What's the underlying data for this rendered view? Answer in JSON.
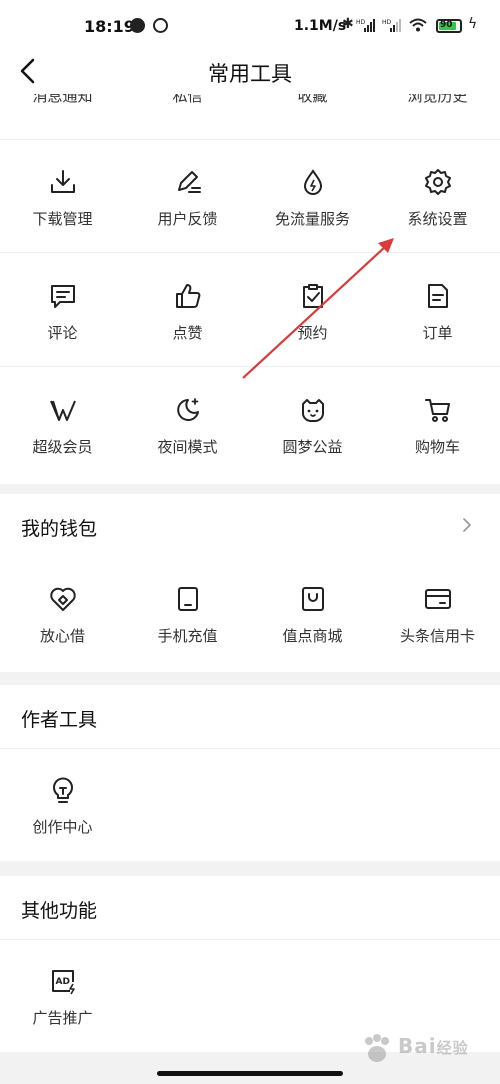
{
  "status_bar": {
    "time": "18:19",
    "net_speed": "1.1M/s",
    "battery_level": "90",
    "battery_percent": 90,
    "icons": [
      "browser-icon",
      "sync-icon",
      "bluetooth-icon",
      "signal-hd-icon",
      "signal-hd-icon",
      "wifi-icon",
      "battery-icon",
      "charging-icon"
    ]
  },
  "header": {
    "title": "常用工具",
    "back_icon": "chevron-left-icon"
  },
  "top_row_partial": [
    "消息通知",
    "私信",
    "收藏",
    "浏览历史"
  ],
  "common_tools": [
    {
      "label": "下载管理",
      "icon": "download-icon"
    },
    {
      "label": "用户反馈",
      "icon": "pen-feedback-icon"
    },
    {
      "label": "免流量服务",
      "icon": "drop-icon"
    },
    {
      "label": "系统设置",
      "icon": "gear-icon"
    },
    {
      "label": "评论",
      "icon": "comment-icon"
    },
    {
      "label": "点赞",
      "icon": "thumbs-up-icon"
    },
    {
      "label": "预约",
      "icon": "clipboard-check-icon"
    },
    {
      "label": "订单",
      "icon": "document-icon"
    },
    {
      "label": "超级会员",
      "icon": "vip-icon"
    },
    {
      "label": "夜间模式",
      "icon": "moon-icon"
    },
    {
      "label": "圆梦公益",
      "icon": "cat-face-icon"
    },
    {
      "label": "购物车",
      "icon": "cart-icon"
    }
  ],
  "wallet": {
    "title": "我的钱包",
    "more_icon": "chevron-right-icon",
    "items": [
      {
        "label": "放心借",
        "icon": "heart-diamond-icon"
      },
      {
        "label": "手机充值",
        "icon": "phone-icon"
      },
      {
        "label": "值点商城",
        "icon": "shopping-bag-icon"
      },
      {
        "label": "头条信用卡",
        "icon": "credit-card-icon"
      }
    ]
  },
  "author_tools": {
    "title": "作者工具",
    "items": [
      {
        "label": "创作中心",
        "icon": "lightbulb-icon"
      }
    ]
  },
  "other_features": {
    "title": "其他功能",
    "items": [
      {
        "label": "广告推广",
        "icon": "ad-icon"
      }
    ]
  },
  "colors": {
    "accent_arrow": "#d93a3a",
    "battery_green": "#2ec94a",
    "background": "#f2f2f2"
  }
}
